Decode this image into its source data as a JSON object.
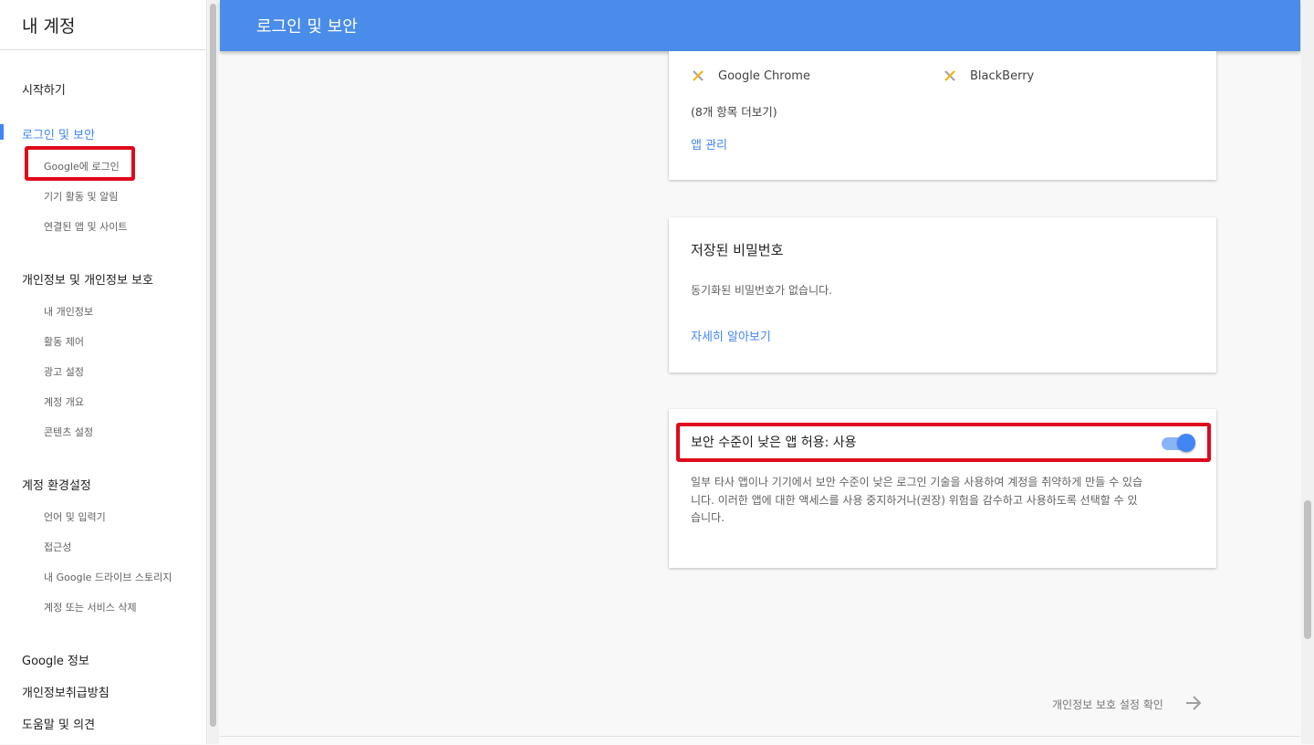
{
  "sidebar": {
    "title": "내 계정",
    "sections": [
      {
        "label": "시작하기"
      },
      {
        "label": "로그인 및 보안",
        "active": true
      },
      {
        "label": "개인정보 및 개인정보 보호"
      },
      {
        "label": "계정 환경설정"
      }
    ],
    "security_items": [
      "Google에 로그인",
      "기기 활동 및 알림",
      "연결된 앱 및 사이트"
    ],
    "privacy_items": [
      "내 개인정보",
      "활동 제어",
      "광고 설정",
      "계정 개요",
      "콘텐츠 설정"
    ],
    "preference_items": [
      "언어 및 입력기",
      "접근성",
      "내 Google 드라이브 스토리지",
      "계정 또는 서비스 삭제"
    ],
    "bottom_links": [
      "Google 정보",
      "개인정보취급방침",
      "도움말 및 의견"
    ]
  },
  "header": {
    "title": "로그인 및 보안"
  },
  "apps_card": {
    "apps": [
      {
        "name": "Google Chrome",
        "icon": "key-icon"
      },
      {
        "name": "BlackBerry",
        "icon": "key-icon"
      }
    ],
    "more": "(8개 항목 더보기)",
    "manage_link": "앱 관리"
  },
  "passwords_card": {
    "title": "저장된 비밀번호",
    "status": "동기화된 비밀번호가 없습니다.",
    "learn_more": "자세히 알아보기"
  },
  "less_secure_card": {
    "title": "보안 수준이 낮은 앱 허용: 사용",
    "toggle_on": true,
    "description": "일부 타사 앱이나 기기에서 보안 수준이 낮은 로그인 기술을 사용하여 계정을 취약하게 만들 수 있습니다. 이러한 앱에 대한 액세스를 사용 중지하거나(권장) 위험을 감수하고 사용하도록 선택할 수 있습니다."
  },
  "footer": {
    "next_label": "개인정보 보호 설정 확인"
  },
  "colors": {
    "accent": "#4285f4",
    "header": "#4a8cea",
    "highlight": "#e0081c"
  }
}
